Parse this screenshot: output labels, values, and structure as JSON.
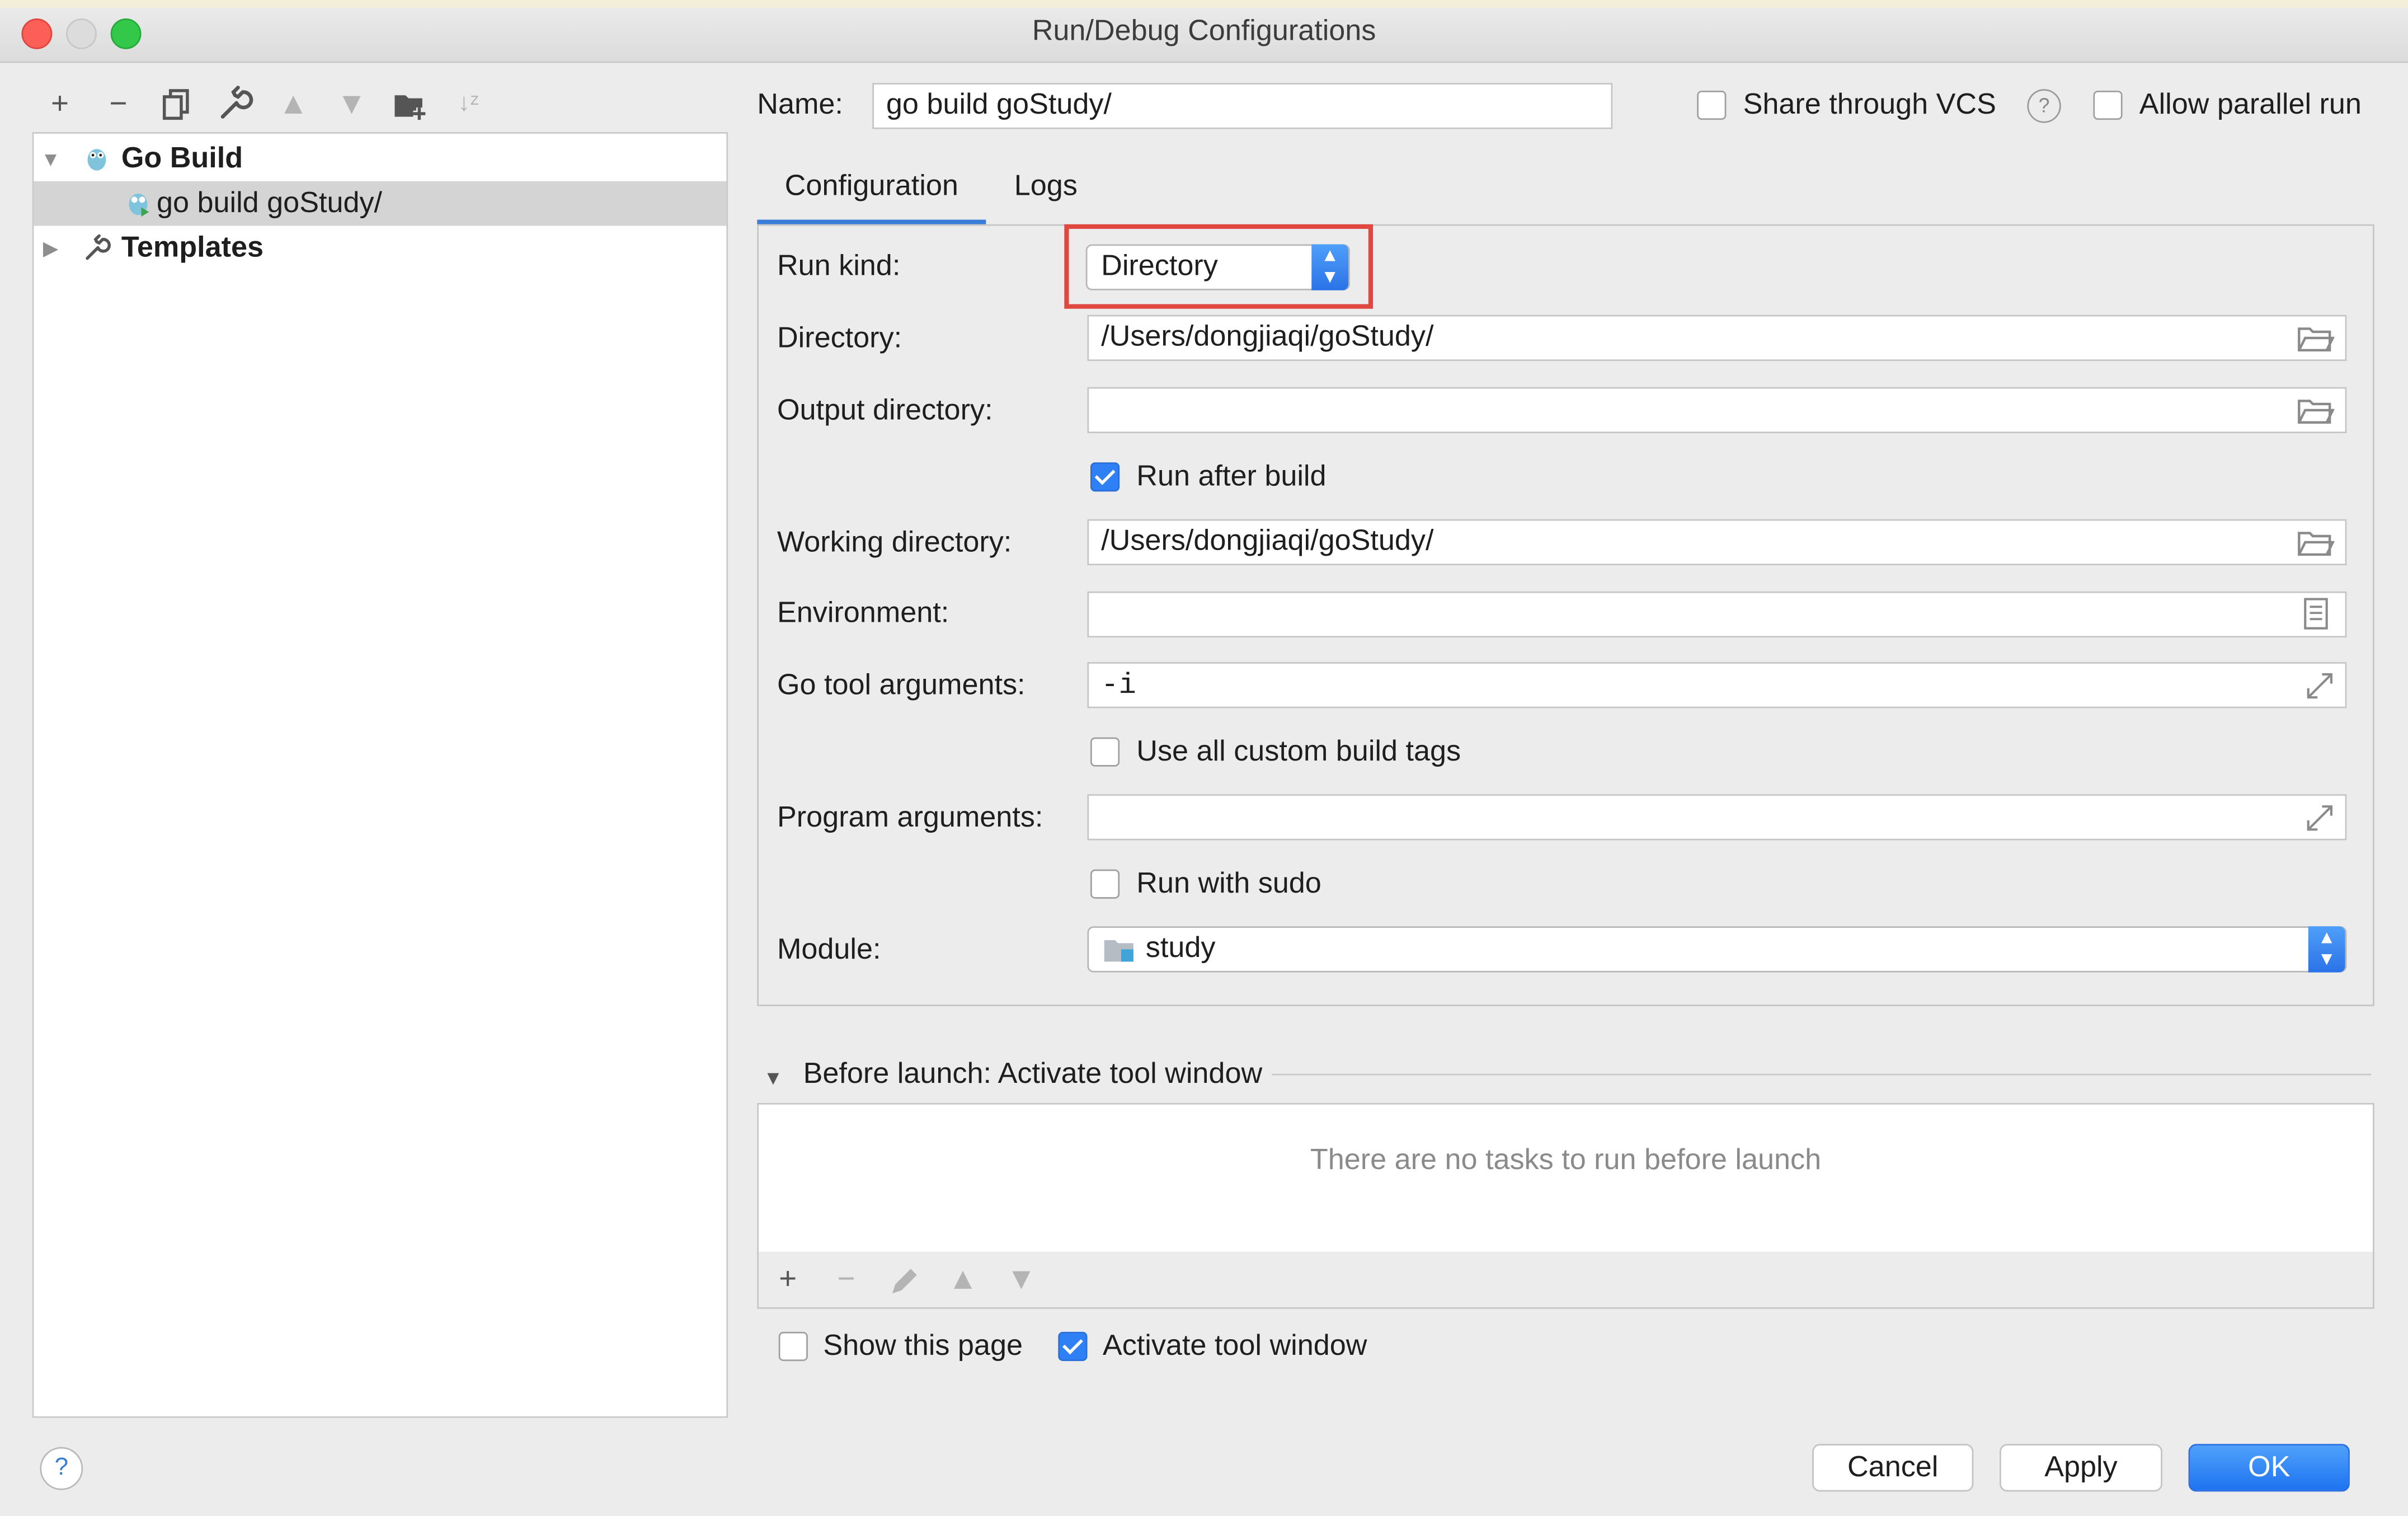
{
  "window": {
    "title": "Run/Debug Configurations"
  },
  "left_toolbar": {
    "icons": [
      "plus-icon",
      "minus-icon",
      "copy-icon",
      "wrench-icon",
      "arrow-up-icon",
      "arrow-down-icon",
      "folder-add-icon",
      "sort-icon"
    ]
  },
  "tree": {
    "items": [
      {
        "label": "Go Build",
        "icon": "gopher-icon",
        "expanded": true
      },
      {
        "label": "go build goStudy/",
        "icon": "gopher-run-icon",
        "selected": true
      },
      {
        "label": "Templates",
        "icon": "wrench-icon",
        "expanded": false
      }
    ]
  },
  "header": {
    "name_label": "Name:",
    "name_value": "go build goStudy/",
    "share_label": "Share through VCS",
    "share_checked": false,
    "parallel_label": "Allow parallel run",
    "parallel_checked": false
  },
  "tabs": [
    {
      "label": "Configuration",
      "active": true
    },
    {
      "label": "Logs",
      "active": false
    }
  ],
  "config": {
    "run_kind_label": "Run kind:",
    "run_kind_value": "Directory",
    "directory_label": "Directory:",
    "directory_value": "/Users/dongjiaqi/goStudy/",
    "output_label": "Output directory:",
    "output_value": "",
    "run_after_build_label": "Run after build",
    "run_after_build_checked": true,
    "working_label": "Working directory:",
    "working_value": "/Users/dongjiaqi/goStudy/",
    "env_label": "Environment:",
    "env_value": "",
    "go_tool_label": "Go tool arguments:",
    "go_tool_value": "-i",
    "custom_tags_label": "Use all custom build tags",
    "custom_tags_checked": false,
    "program_args_label": "Program arguments:",
    "program_args_value": "",
    "sudo_label": "Run with sudo",
    "sudo_checked": false,
    "module_label": "Module:",
    "module_value": "study"
  },
  "before_launch": {
    "title": "Before launch: Activate tool window",
    "empty_text": "There are no tasks to run before launch",
    "toolbar_icons": [
      "plus-icon",
      "minus-icon",
      "pencil-icon",
      "arrow-up-icon",
      "arrow-down-icon"
    ]
  },
  "footer": {
    "show_page_label": "Show this page",
    "show_page_checked": false,
    "activate_label": "Activate tool window",
    "activate_checked": true,
    "cancel_label": "Cancel",
    "apply_label": "Apply",
    "ok_label": "OK"
  },
  "colors": {
    "accent": "#2f7ff5",
    "highlight_border": "#e0473e",
    "close": "#fc5f57",
    "minimize": "#dcdcdc",
    "zoom": "#34c84a"
  }
}
